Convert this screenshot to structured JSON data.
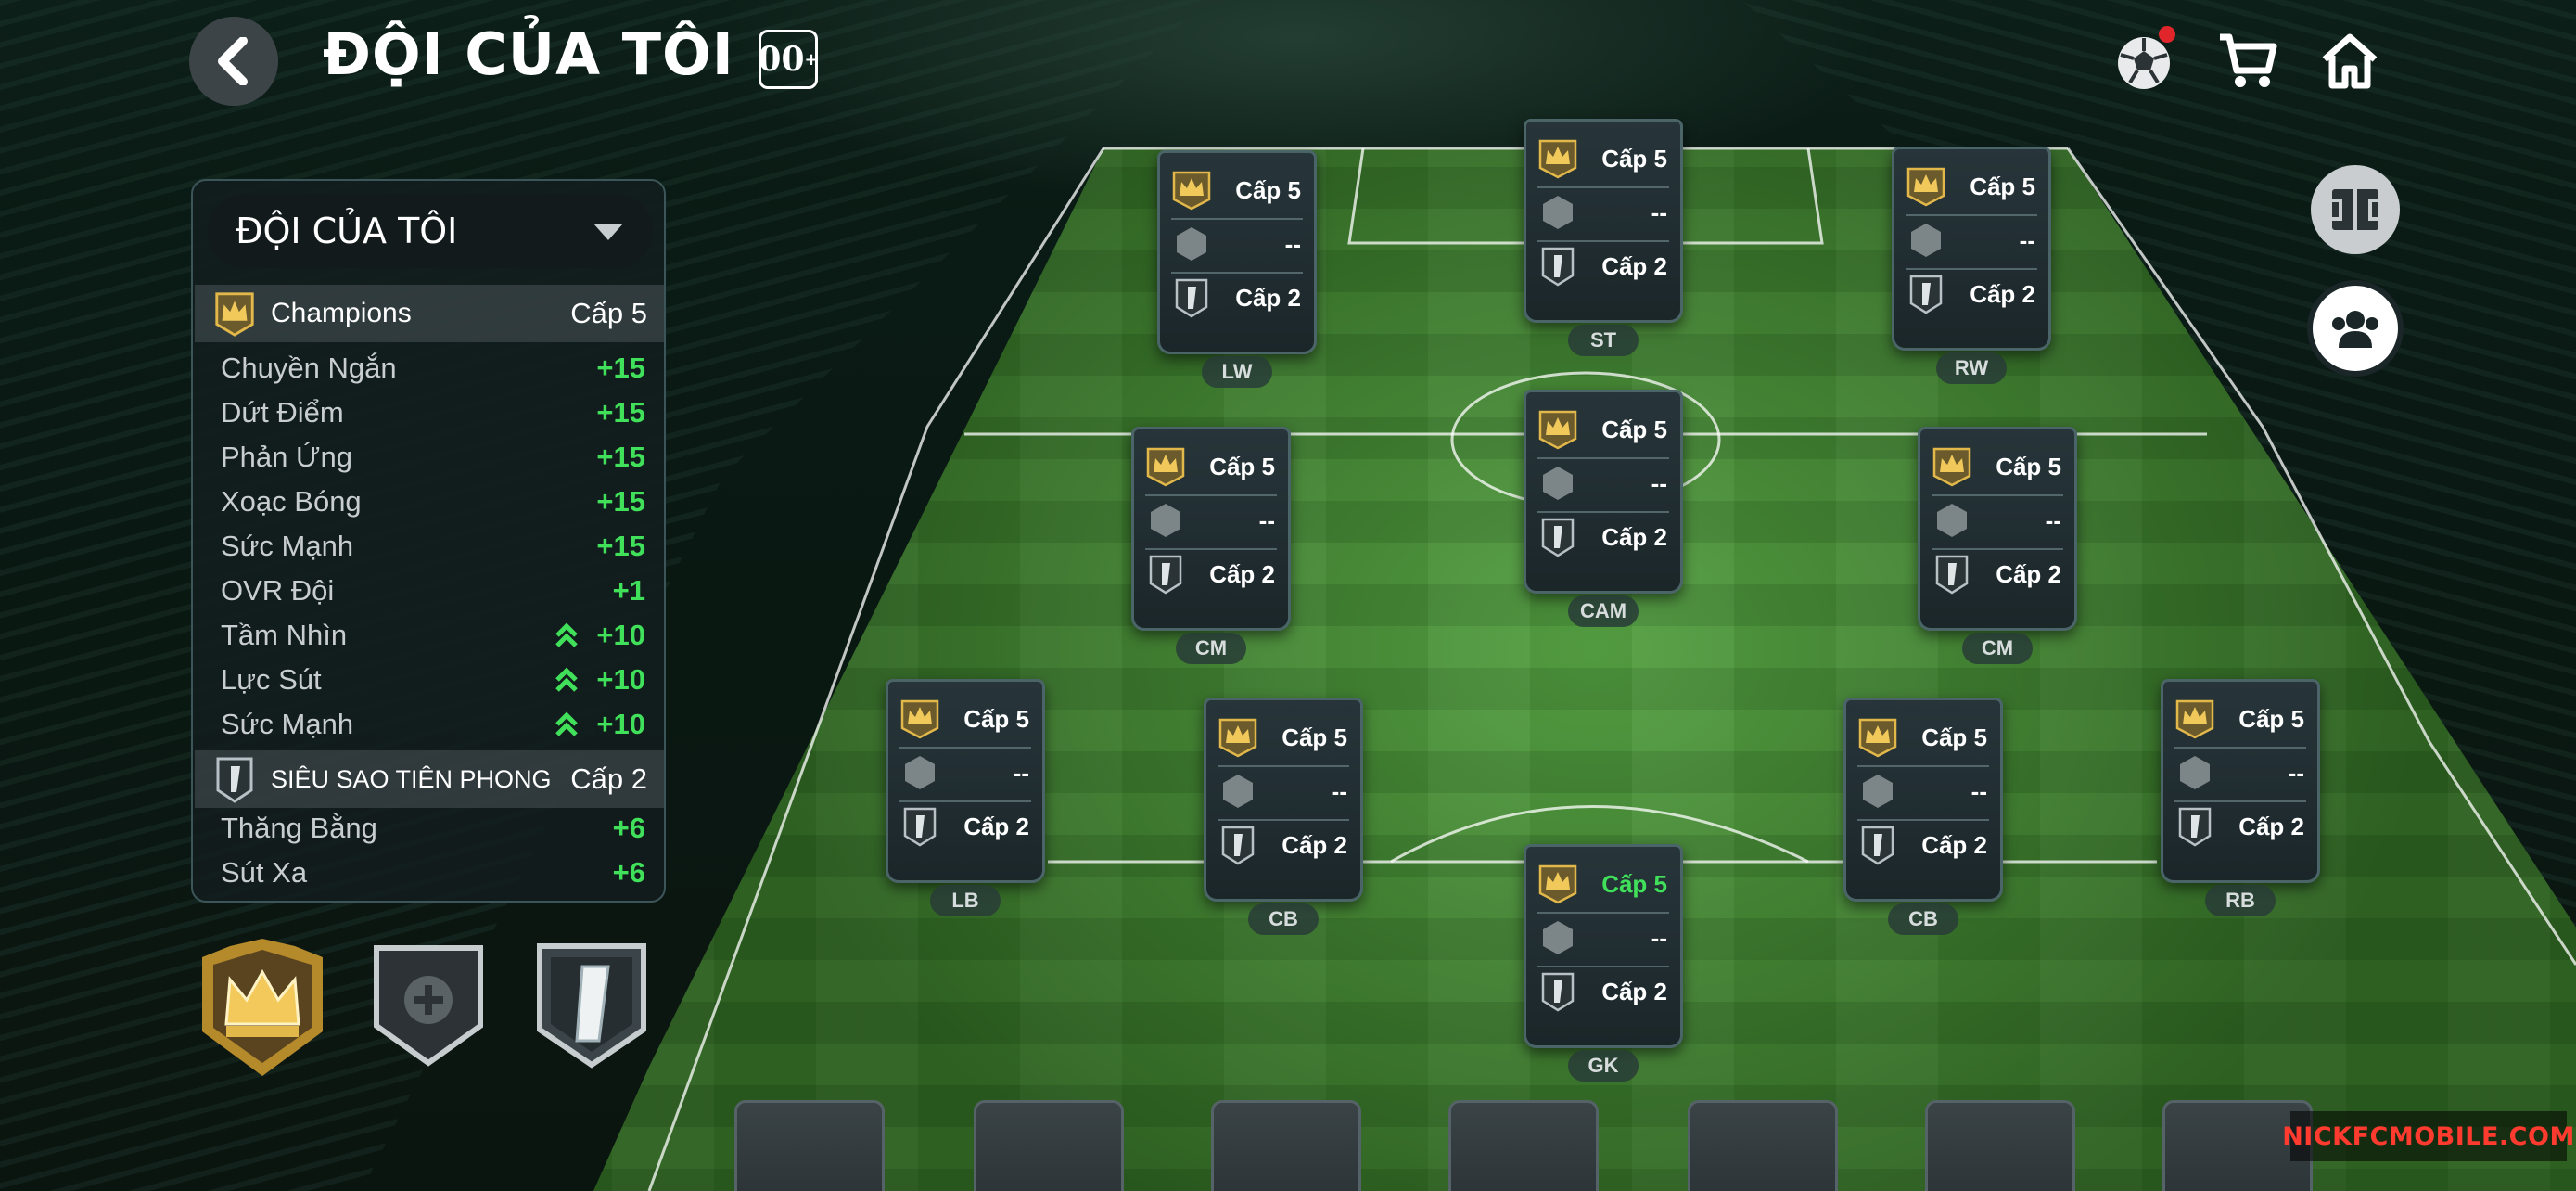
{
  "header": {
    "title": "ĐỘI CỦA TÔI",
    "badge": "00"
  },
  "top_icons": [
    "ball-icon",
    "cart-icon",
    "home-icon"
  ],
  "side_buttons": [
    "formation-icon",
    "team-group-icon"
  ],
  "panel": {
    "dropdown_label": "ĐỘI CỦA TÔI",
    "sections": [
      {
        "name": "Champions",
        "level": "Cấp 5",
        "icon": "crown-icon",
        "stats": [
          {
            "label": "Chuyền Ngắn",
            "value": "+15",
            "boosted": false
          },
          {
            "label": "Dứt Điểm",
            "value": "+15",
            "boosted": false
          },
          {
            "label": "Phản Ứng",
            "value": "+15",
            "boosted": false
          },
          {
            "label": "Xoạc Bóng",
            "value": "+15",
            "boosted": false
          },
          {
            "label": "Sức Mạnh",
            "value": "+15",
            "boosted": false
          },
          {
            "label": "OVR Đội",
            "value": "+1",
            "boosted": false
          },
          {
            "label": "Tầm Nhìn",
            "value": "+10",
            "boosted": true
          },
          {
            "label": "Lực Sút",
            "value": "+10",
            "boosted": true
          },
          {
            "label": "Sức Mạnh",
            "value": "+10",
            "boosted": true
          }
        ]
      },
      {
        "name": "SIÊU SAO TIÊN PHONG",
        "level": "Cấp 2",
        "icon": "pioneer-icon",
        "stats": [
          {
            "label": "Thăng Bằng",
            "value": "+6",
            "boosted": false
          },
          {
            "label": "Sút Xa",
            "value": "+6",
            "boosted": false
          }
        ]
      }
    ]
  },
  "badges": [
    "champions-crown-badge",
    "add-badge-slot",
    "pioneer-badge"
  ],
  "players": [
    {
      "position": "LW",
      "row1": "Cấp 5",
      "row2": "--",
      "row3": "Cấp 2"
    },
    {
      "position": "ST",
      "row1": "Cấp 5",
      "row2": "--",
      "row3": "Cấp 2"
    },
    {
      "position": "RW",
      "row1": "Cấp 5",
      "row2": "--",
      "row3": "Cấp 2"
    },
    {
      "position": "CM",
      "row1": "Cấp 5",
      "row2": "--",
      "row3": "Cấp 2"
    },
    {
      "position": "CAM",
      "row1": "Cấp 5",
      "row2": "--",
      "row3": "Cấp 2"
    },
    {
      "position": "CM",
      "row1": "Cấp 5",
      "row2": "--",
      "row3": "Cấp 2"
    },
    {
      "position": "LB",
      "row1": "Cấp 5",
      "row2": "--",
      "row3": "Cấp 2"
    },
    {
      "position": "CB",
      "row1": "Cấp 5",
      "row2": "--",
      "row3": "Cấp 2"
    },
    {
      "position": "CB",
      "row1": "Cấp 5",
      "row2": "--",
      "row3": "Cấp 2"
    },
    {
      "position": "RB",
      "row1": "Cấp 5",
      "row2": "--",
      "row3": "Cấp 2"
    },
    {
      "position": "GK",
      "row1": "Cấp 5",
      "row2": "--",
      "row3": "Cấp 2",
      "row1_highlight": true
    }
  ],
  "bench_slots": 7,
  "watermark": "NICKFCMOBILE.COM",
  "colors": {
    "accent_green": "#41e05a",
    "gold": "#e2b84a",
    "notification": "#e0262b"
  }
}
